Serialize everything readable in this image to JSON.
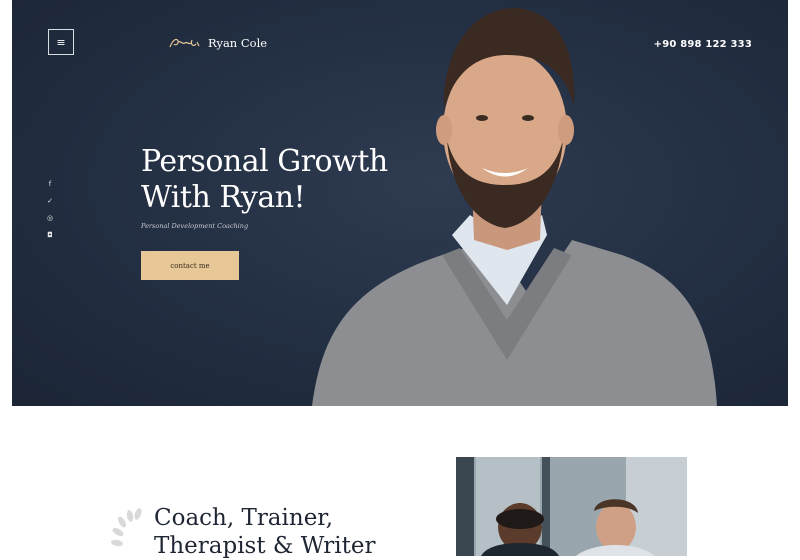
{
  "header": {
    "menu_icon": "menu-icon",
    "brand_name": "Ryan Cole",
    "phone": "+90 898 122 333"
  },
  "hero": {
    "headline_line1": "Personal Growth",
    "headline_line2": "With Ryan!",
    "subtitle": "Personal Development Coaching",
    "cta_label": "contact me",
    "socials": [
      {
        "icon": "facebook-icon",
        "glyph": "f"
      },
      {
        "icon": "twitter-icon",
        "glyph": "✓"
      },
      {
        "icon": "pinterest-icon",
        "glyph": "◎"
      },
      {
        "icon": "instagram-icon",
        "glyph": "◘"
      }
    ]
  },
  "about": {
    "title_line1": "Coach, Trainer,",
    "title_line2": "Therapist & Writer"
  },
  "colors": {
    "hero_bg": "#243044",
    "accent": "#e7c795",
    "text_dark": "#1f2633"
  }
}
